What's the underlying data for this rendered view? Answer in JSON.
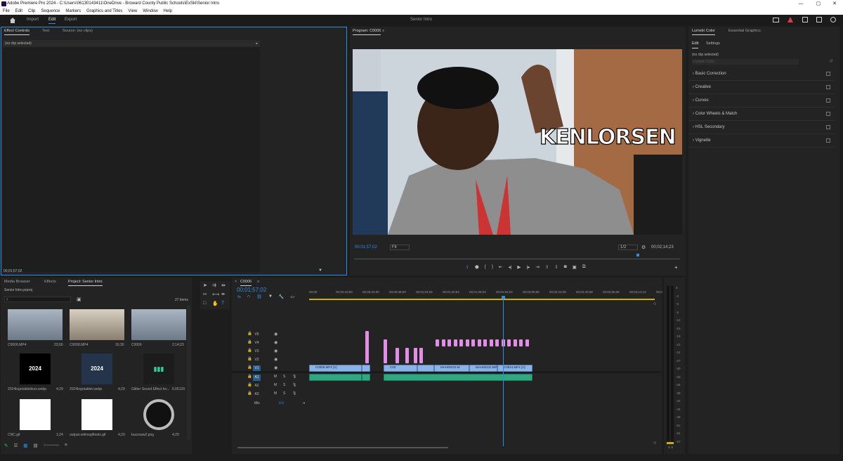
{
  "window": {
    "title": "Adobe Premiere Pro 2024 - C:\\Users\\06130143411\\OneDrive - Broward County Public Schools\\ExSkl\\Senior Intro",
    "minimize": "—",
    "maximize": "▢",
    "close": "✕"
  },
  "menu": [
    "File",
    "Edit",
    "Clip",
    "Sequence",
    "Markers",
    "Graphics and Titles",
    "View",
    "Window",
    "Help"
  ],
  "workspace": {
    "import": "Import",
    "edit": "Edit",
    "export": "Export",
    "project_title": "Senior Intro"
  },
  "effect_controls": {
    "tabs": [
      "Effect Controls",
      "Text",
      "Source: (no clips)"
    ],
    "no_clip": "(no clip selected)",
    "timecode": "00;01;57;02"
  },
  "program": {
    "title": "Program: C0006",
    "timecode_left": "00;01;57;02",
    "fit": "Fit",
    "resolution": "1/2",
    "timecode_right": "00;02;14;23",
    "overlay_text": "KENLORSEN"
  },
  "lumetri": {
    "tabs": [
      "Lumetri Color",
      "Essential Graphics"
    ],
    "subtabs": [
      "Edit",
      "Settings"
    ],
    "no_clip": "(no clip selected)",
    "dropdown": "Lumetri Color",
    "sections": [
      "Basic Correction",
      "Creative",
      "Curves",
      "Color Wheels & Match",
      "HSL Secondary",
      "Vignette"
    ]
  },
  "project": {
    "tabs": [
      "Media Browser",
      "Effects",
      "Project: Senior Intro"
    ],
    "file": "Senior Intro.prproj",
    "items_count": "27 items",
    "items": [
      {
        "name": "C0006.MP4",
        "dur": "23;00"
      },
      {
        "name": "C0008.MP4",
        "dur": "16;30"
      },
      {
        "name": "C0006",
        "dur": "2;14;23"
      },
      {
        "name": "2024logotabletless.webp",
        "dur": "4;29"
      },
      {
        "name": "2024logotablet.webp",
        "dur": "4;29"
      },
      {
        "name": "Glitter Sound Effect for...",
        "dur": "6.05129"
      },
      {
        "name": "CNC.gif",
        "dur": "1;24"
      },
      {
        "name": "output-onlinegiftools.gif",
        "dur": "4;20"
      },
      {
        "name": "buzzsaw2.png",
        "dur": "4;29"
      }
    ]
  },
  "timeline": {
    "seq_tab": "C0006",
    "timecode": "00;01;57;02",
    "ruler": [
      "00;00",
      "00;00;16;00",
      "00;00;32;00",
      "00;00;48;00",
      "00;01;04;04",
      "00;01;20;04",
      "00;01;36;04",
      "00;01;52;04",
      "00;02;08;06",
      "00;02;24;08",
      "00;02;40;08",
      "00;02;56;08",
      "00;03;12;12",
      "00;0"
    ],
    "video_tracks": [
      "V5",
      "V4",
      "V3",
      "V2",
      "V1"
    ],
    "audio_tracks": [
      "A1",
      "A2",
      "A3"
    ],
    "mix": "Mix",
    "mix_val": "0.0",
    "clip_labels": [
      "C0006.MP4 [V]",
      "C00",
      "MAH00223.M",
      "MAH00232.MP4 [V]",
      "C0024.MP4 [V]"
    ]
  },
  "meter": {
    "scale": [
      "0",
      "-3",
      "-6",
      "-9",
      "-12",
      "-15",
      "-18",
      "-21",
      "-24",
      "-27",
      "-30",
      "-33",
      "-36",
      "-39",
      "-42",
      "-45",
      "-48",
      "-51",
      "-54",
      "-57"
    ],
    "bottom": "S S"
  },
  "colors": {
    "accent": "#2d8ceb",
    "video_clip": "#8ab3e6",
    "audio_clip": "#2fa882",
    "graphic_clip": "#e28ee6",
    "playhead": "#2d8ceb"
  }
}
